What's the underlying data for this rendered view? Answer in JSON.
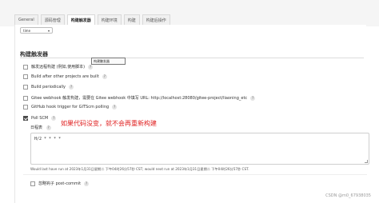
{
  "tabs": [
    "General",
    "源码管理",
    "构建触发器",
    "构建环境",
    "构建",
    "构建后操作"
  ],
  "top_select_value": "time",
  "section_title": "构建触发器",
  "tooltip": "构建触发器",
  "triggers": [
    {
      "label": "触发远程构建 (例如,使用脚本)",
      "checked": false,
      "help": "?"
    },
    {
      "label": "Build after other projects are built",
      "checked": false,
      "help": "?"
    },
    {
      "label": "Build periodically",
      "checked": false,
      "help": "?"
    },
    {
      "label": "Gitee webhook 触发构建，需要在 Gitee webhook 中填写 URL: http://localhost:28080/gitee-project/liaoning_etc",
      "checked": false,
      "help": "?"
    },
    {
      "label": "GitHub hook trigger for GITScm polling",
      "checked": false,
      "help": "?"
    },
    {
      "label": "Poll SCM",
      "checked": true,
      "help": "?"
    }
  ],
  "schedule_label": "日程表",
  "schedule_help": "?",
  "annotation": "如果代码没变，就不会再重新构建",
  "cron_value": "H/2 * * * *",
  "run_info": "Would last have run at 2023年1月31日星期二 下午04时26分57秒 CST; would next run at 2023年1月31日星期二 下午04时26分57秒 CST.",
  "ignore_post_commit": {
    "label": "忽略钩子 post-commit",
    "checked": false,
    "help": "?"
  },
  "watermark": "CSDN @m0_67938035"
}
